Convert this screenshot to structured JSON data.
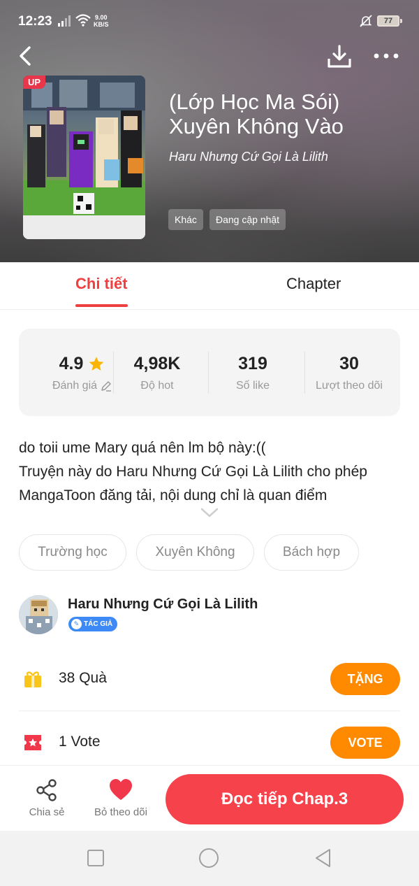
{
  "status_bar": {
    "time": "12:23",
    "net_speed_value": "9.00",
    "net_speed_unit": "KB/S",
    "battery": "77"
  },
  "header": {
    "back_icon": "chevron-left-icon",
    "download_icon": "download-icon",
    "more_icon": "more-horizontal-icon"
  },
  "cover": {
    "badge": "UP"
  },
  "story": {
    "title": "(Lớp Học Ma Sói) Xuyên Không Vào",
    "author": "Haru Nhưng Cứ Gọi Là Lilith",
    "tags": [
      "Khác",
      "Đang cập nhật"
    ]
  },
  "tabs": [
    {
      "label": "Chi tiết",
      "active": true
    },
    {
      "label": "Chapter",
      "active": false
    }
  ],
  "stats": [
    {
      "value": "4.9",
      "label": "Đánh giá"
    },
    {
      "value": "4,98K",
      "label": "Độ hot"
    },
    {
      "value": "319",
      "label": "Số like"
    },
    {
      "value": "30",
      "label": "Lượt theo dõi"
    }
  ],
  "description": {
    "line1": "do toii ume Mary quá nên lm bộ này:((",
    "line2": "Truyện này do Haru Nhưng Cứ Gọi Là Lilith cho phép MangaToon đăng tải, nội dung chỉ là quan điểm"
  },
  "genres": [
    "Trường học",
    "Xuyên Không",
    "Bách hợp"
  ],
  "author_section": {
    "name": "Haru Nhưng Cứ Gọi Là Lilith",
    "badge": "TÁC GIẢ"
  },
  "gifts": {
    "text": "38 Quà",
    "button": "TẶNG"
  },
  "votes": {
    "text": "1 Vote",
    "button": "VOTE"
  },
  "actions": {
    "share": "Chia sẻ",
    "unfollow": "Bỏ theo dõi",
    "read": "Đọc tiếp Chap.3"
  },
  "colors": {
    "accent_red": "#ee4040",
    "button_orange": "#ff8a00",
    "read_button": "#f5424b",
    "badge_blue": "#3d8af7"
  }
}
